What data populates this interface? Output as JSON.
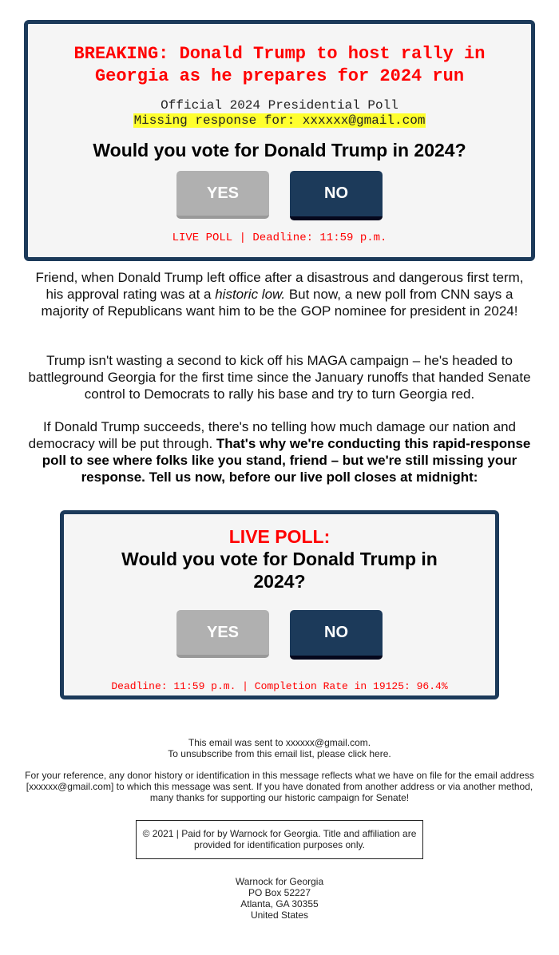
{
  "poll_top": {
    "headline": "BREAKING: Donald Trump to host rally in Georgia as he prepares for 2024 run",
    "subtitle": "Official 2024 Presidential Poll",
    "missing_response": "Missing response for: xxxxxx@gmail.com",
    "question": "Would you vote for Donald Trump in 2024?",
    "yes_label": "YES",
    "no_label": "NO",
    "footer": "LIVE POLL | Deadline: 11:59 p.m."
  },
  "body": {
    "para1_a": "Friend, when Donald Trump left office after a disastrous and dangerous first term, his approval rating was at a ",
    "para1_italic": "historic low.",
    "para1_b": " But now, a new poll from CNN says a majority of Republicans want him to be the GOP nominee for president in 2024!",
    "para2": "Trump isn't wasting a second to kick off his MAGA campaign – he's headed to battleground Georgia for the first time since the January runoffs that handed Senate control to Democrats to rally his base and try to turn Georgia red.",
    "para3_a": "If Donald Trump succeeds, there's no telling how much damage our nation and democracy will be put through. ",
    "para3_bold": "That's why we're conducting this rapid-response poll to see where folks like you stand, friend – but we're still missing your response. Tell us now, before our live poll closes at midnight:"
  },
  "poll_bottom": {
    "live_label": "LIVE POLL:",
    "question": "Would you vote for Donald Trump in 2024?",
    "yes_label": "YES",
    "no_label": "NO",
    "footer": "Deadline: 11:59 p.m. | Completion Rate in 19125: 96.4%"
  },
  "footer": {
    "sent_to": "This email was sent to xxxxxx@gmail.com.",
    "unsubscribe_prefix": "To unsubscribe from this email list, please ",
    "unsubscribe_link": "click here",
    "unsubscribe_suffix": ".",
    "reference": "For your reference, any donor history or identification in this message reflects what we have on file for the email address [xxxxxx@gmail.com] to which this message was sent. If you have donated from another address or via another method, many thanks for supporting our historic campaign for Senate!",
    "paid_for": "© 2021 | Paid for by Warnock for Georgia. Title and affiliation are provided for identification purposes only.",
    "address": {
      "org": "Warnock for Georgia",
      "po_box": "PO Box 52227",
      "city": "Atlanta, GA 30355",
      "country": "United States"
    }
  },
  "colors": {
    "navy": "#1c3a5a",
    "alert_red": "#ff0000",
    "highlight_yellow": "#ffff2e",
    "yes_gray": "#b0b0b0",
    "panel_bg": "#f5f5f5"
  }
}
